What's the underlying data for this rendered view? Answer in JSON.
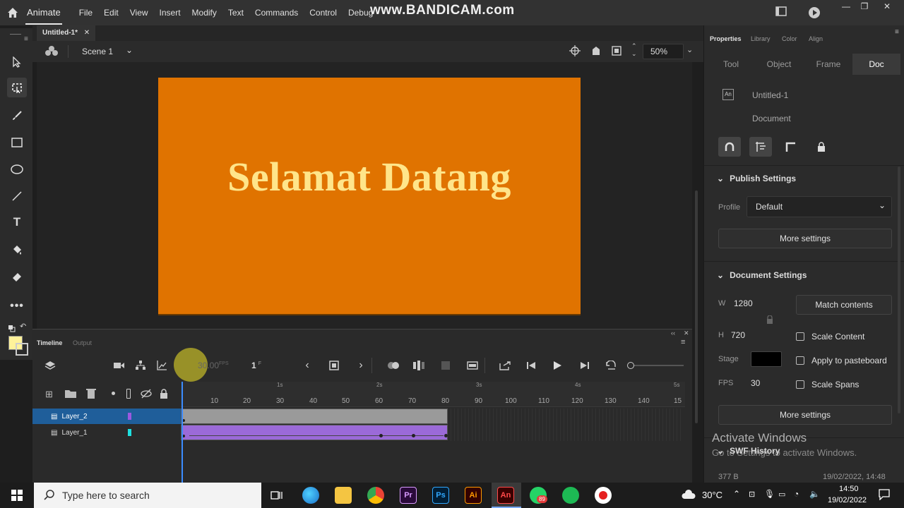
{
  "app": {
    "name": "Animate",
    "menus": [
      "File",
      "Edit",
      "View",
      "Insert",
      "Modify",
      "Text",
      "Commands",
      "Control",
      "Debug"
    ],
    "watermark": "www.BANDICAM.com"
  },
  "document": {
    "tab_label": "Untitled-1*",
    "scene_label": "Scene 1",
    "zoom": "50%",
    "stage_text": "Selamat Datang",
    "stage_color": "#e07300",
    "text_color": "#ffe58a"
  },
  "timeline": {
    "tabs": [
      "Timeline",
      "Output"
    ],
    "fps": "30.00",
    "fps_unit": "FPS",
    "frame": "1",
    "frame_unit": "F",
    "layers": [
      {
        "name": "Layer_2",
        "color": "#9b59e0",
        "selected": true
      },
      {
        "name": "Layer_1",
        "color": "#1ee0e0",
        "selected": false
      }
    ],
    "ruler_numbers": [
      "10",
      "20",
      "30",
      "40",
      "50",
      "60",
      "70",
      "80",
      "90",
      "100",
      "110",
      "120",
      "130",
      "140",
      "15"
    ],
    "ruler_seconds": [
      "1s",
      "2s",
      "3s",
      "4s",
      "5s"
    ]
  },
  "properties": {
    "panel_tabs": [
      "Properties",
      "Library",
      "Color",
      "Align"
    ],
    "sub_tabs": [
      "Tool",
      "Object",
      "Frame",
      "Doc"
    ],
    "doc_name": "Untitled-1",
    "doc_type": "Document",
    "publish": {
      "header": "Publish Settings",
      "profile_label": "Profile",
      "profile_value": "Default",
      "more": "More settings"
    },
    "doc_settings": {
      "header": "Document Settings",
      "w_label": "W",
      "w_value": "1280",
      "h_label": "H",
      "h_value": "720",
      "match": "Match contents",
      "scale_content": "Scale Content",
      "stage_label": "Stage",
      "apply_pasteboard": "Apply to pasteboard",
      "fps_label": "FPS",
      "fps_value": "30",
      "scale_spans": "Scale Spans",
      "more": "More settings"
    },
    "swf": {
      "header": "SWF History",
      "size": "377 B",
      "date": "19/02/2022, 14:48"
    }
  },
  "activation": {
    "line1": "Activate Windows",
    "line2": "Go to Settings to activate Windows."
  },
  "taskbar": {
    "search_placeholder": "Type here to search",
    "weather": "30°C",
    "time": "14:50",
    "date": "19/02/2022",
    "badge": "89"
  }
}
